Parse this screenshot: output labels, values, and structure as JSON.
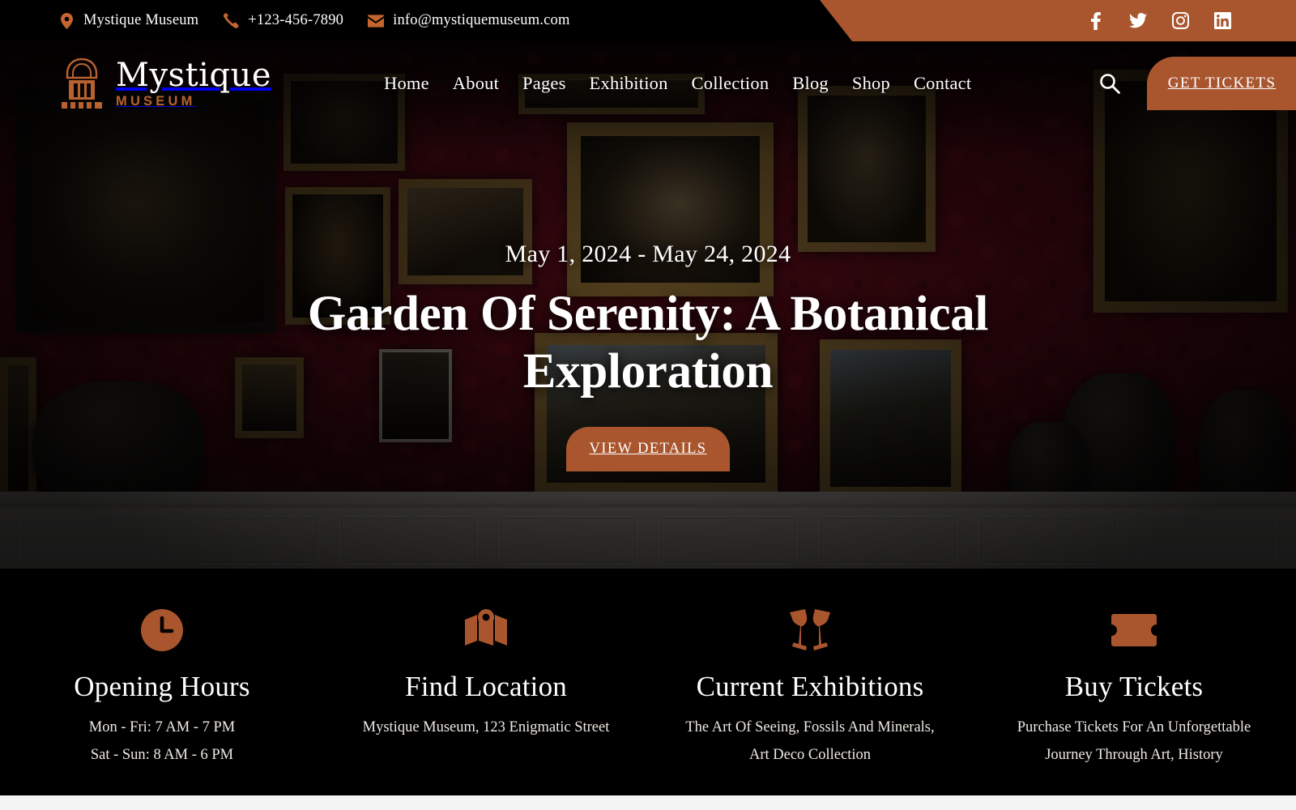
{
  "topbar": {
    "items": [
      {
        "icon": "location-pin-icon",
        "label": "Mystique Museum"
      },
      {
        "icon": "phone-icon",
        "label": "+123-456-7890"
      },
      {
        "icon": "envelope-icon",
        "label": "info@mystiquemuseum.com"
      }
    ],
    "socials": [
      "facebook-icon",
      "twitter-icon",
      "instagram-icon",
      "linkedin-icon"
    ],
    "bg_color": "#a9562f"
  },
  "brand": {
    "title": "Mystique",
    "subtitle": "MUSEUM",
    "mark": "museum-building-icon"
  },
  "nav": {
    "links": [
      {
        "label": "Home"
      },
      {
        "label": "About"
      },
      {
        "label": "Pages"
      },
      {
        "label": "Exhibition"
      },
      {
        "label": "Collection"
      },
      {
        "label": "Blog"
      },
      {
        "label": "Shop"
      },
      {
        "label": "Contact"
      }
    ],
    "search_icon": "search-icon",
    "cta_label": "GET TICKETS"
  },
  "hero": {
    "date_range": "May 1, 2024 - May 24, 2024",
    "title": "Garden Of Serenity: A Botanical Exploration",
    "cta_label": "VIEW DETAILS",
    "slides": [
      {
        "active": true
      },
      {
        "active": false
      },
      {
        "active": false
      }
    ]
  },
  "info_cards": [
    {
      "icon": "clock-icon",
      "title": "Opening Hours",
      "lines": [
        "Mon - Fri: 7 AM - 7 PM",
        "Sat - Sun: 8 AM - 6 PM"
      ]
    },
    {
      "icon": "map-location-icon",
      "title": "Find Location",
      "lines": [
        "Mystique Museum, 123 Enigmatic Street"
      ]
    },
    {
      "icon": "cheers-glasses-icon",
      "title": "Current Exhibitions",
      "lines": [
        "The Art Of Seeing, Fossils And Minerals, Art Deco Collection"
      ]
    },
    {
      "icon": "ticket-icon",
      "title": "Buy Tickets",
      "lines": [
        "Purchase Tickets For An Unforgettable Journey Through Art, History"
      ]
    }
  ],
  "colors": {
    "accent": "#a9562f",
    "dark": "#000000",
    "text_light": "#ffffff",
    "page_bg": "#f4f4f4"
  }
}
